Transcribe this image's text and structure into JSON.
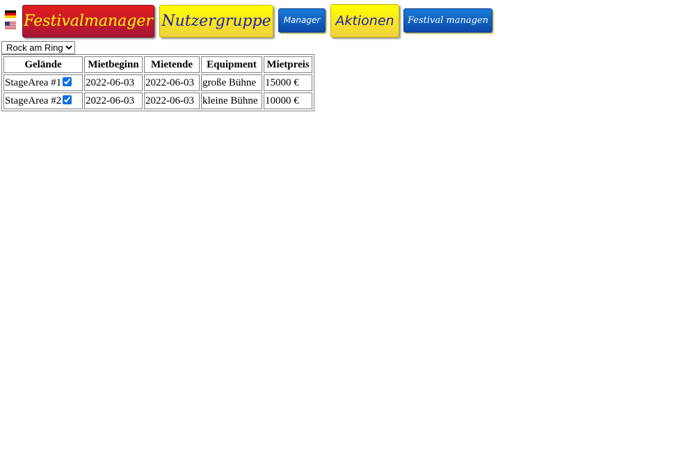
{
  "language_flags": [
    {
      "icon": "germany-flag-icon"
    },
    {
      "icon": "usa-flag-icon"
    }
  ],
  "nav": {
    "festivalmanager": "Festivalmanager",
    "nutzergruppe": "Nutzergruppe",
    "manager": "Manager",
    "aktionen": "Aktionen",
    "festival_managen": "Festival managen"
  },
  "colors": {
    "red_button": "#c41a2b",
    "red_button_text": "#fffa0a",
    "yellow_button": "#f5e020",
    "yellow_button_text": "#2020a8",
    "blue_button": "#0b5fc2",
    "blue_button_text": "#ffffff"
  },
  "festival_select": {
    "selected": "Rock am Ring"
  },
  "table": {
    "headers": [
      "Gelände",
      "Mietbeginn",
      "Mietende",
      "Equipment",
      "Mietpreis"
    ],
    "rows": [
      {
        "area": "StageArea #1",
        "checked": true,
        "begin": "2022-06-03",
        "end": "2022-06-03",
        "equipment": "große Bühne",
        "price": "15000 €"
      },
      {
        "area": "StageArea #2",
        "checked": true,
        "begin": "2022-06-03",
        "end": "2022-06-03",
        "equipment": "kleine Bühne",
        "price": "10000 €"
      }
    ]
  }
}
